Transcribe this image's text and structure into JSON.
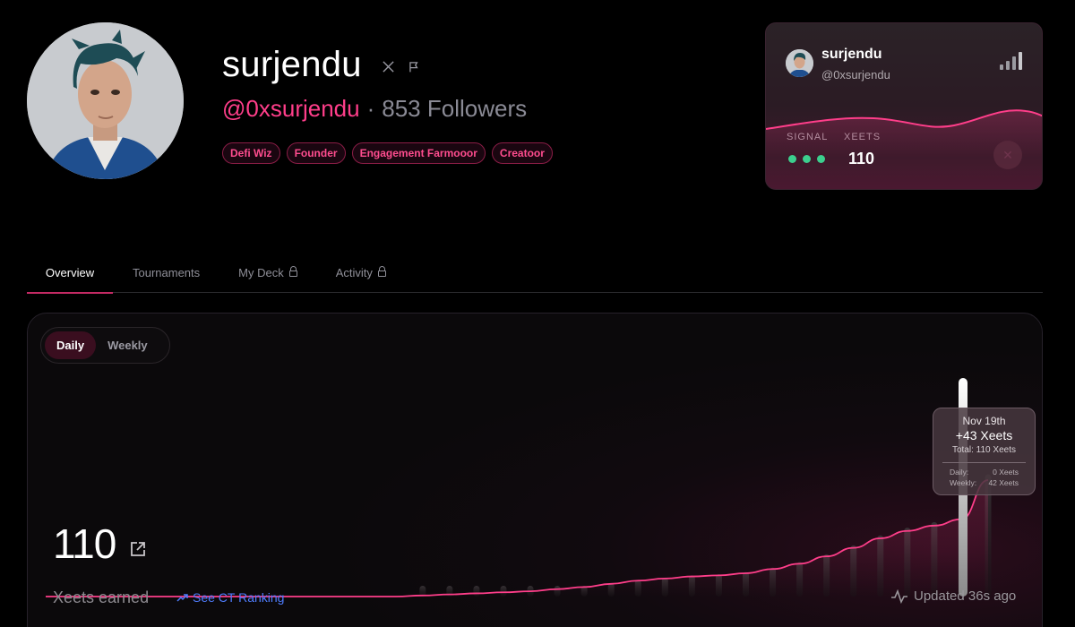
{
  "profile": {
    "name": "surjendu",
    "handle": "@0xsurjendu",
    "separator": "·",
    "followers": "853 Followers",
    "icons": [
      "x-logo-icon",
      "flag-icon"
    ],
    "tags": [
      "Defi Wiz",
      "Founder",
      "Engagement Farmooor",
      "Creatoor"
    ]
  },
  "card": {
    "name": "surjendu",
    "handle": "@0xsurjendu",
    "signal_label": "SIGNAL",
    "xeets_label": "XEETS",
    "xeets_value": "110",
    "signal_dots": 3,
    "icons": [
      "signal-strength-icon",
      "brand-logo-icon"
    ]
  },
  "tabs": [
    {
      "label": "Overview",
      "active": true,
      "locked": false
    },
    {
      "label": "Tournaments",
      "active": false,
      "locked": false
    },
    {
      "label": "My Deck",
      "active": false,
      "locked": true
    },
    {
      "label": "Activity",
      "active": false,
      "locked": true
    }
  ],
  "panel": {
    "toggle": {
      "daily": "Daily",
      "weekly": "Weekly",
      "selected": "Daily"
    },
    "value": "110",
    "value_caption": "Xeets earned",
    "ranking_link": "See CT Ranking",
    "updated": "Updated 36s ago",
    "tooltip": {
      "date": "Nov 19th",
      "change": "+43 Xeets",
      "total": "Total: 110 Xeets",
      "daily_label": "Daily:",
      "daily_value": "0 Xeets",
      "weekly_label": "Weekly:",
      "weekly_value": "42 Xeets"
    }
  },
  "colors": {
    "accent": "#ff3e8a",
    "tag_border": "#8a1d46",
    "link": "#4f7dff",
    "signal_green": "#3ccf8e",
    "background": "#000000"
  },
  "chart_data": {
    "type": "line",
    "series": [
      {
        "values": [
          0,
          0,
          0,
          0,
          0,
          0,
          0,
          0,
          0,
          0,
          0,
          0,
          0,
          0,
          1,
          2,
          3,
          4,
          5,
          7,
          9,
          12,
          15,
          17,
          19,
          20,
          22,
          26,
          31,
          38,
          46,
          55,
          62,
          67,
          73,
          110
        ]
      }
    ],
    "highlighted_point": {
      "label": "Nov 19th",
      "value": 110
    }
  }
}
